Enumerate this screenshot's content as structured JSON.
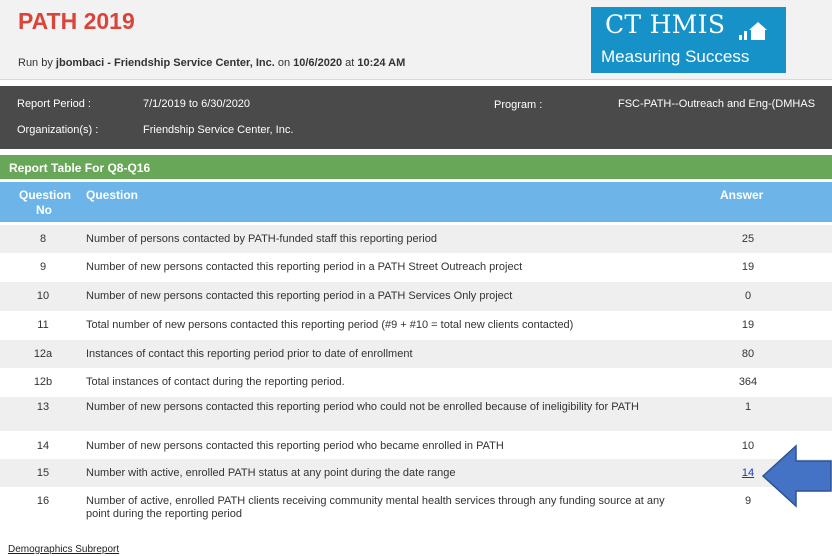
{
  "header": {
    "title": "PATH 2019",
    "run_by_prefix": "Run by ",
    "run_by_user": "jbombaci - Friendship Service Center, Inc.",
    "run_by_on": " on ",
    "run_date": "10/6/2020",
    "run_at": " at ",
    "run_time": "10:24 AM"
  },
  "logo": {
    "top": "CT HMIS",
    "bottom": "Measuring Success",
    "icon": "house-bars-icon"
  },
  "meta": {
    "report_period_label": "Report Period :",
    "report_period_value": "7/1/2019 to 6/30/2020",
    "program_label": "Program :",
    "program_value": "FSC-PATH--Outreach and Eng-(DMHAS",
    "organization_label": "Organization(s) :",
    "organization_value": "Friendship Service Center, Inc."
  },
  "table": {
    "section_title": "Report Table For Q8-Q16",
    "col_no_line1": "Question",
    "col_no_line2": "No",
    "col_question": "Question",
    "col_answer": "Answer",
    "rows": [
      {
        "no": "8",
        "question": "Number of persons contacted by PATH-funded staff this reporting period",
        "answer": "25"
      },
      {
        "no": "9",
        "question": "Number of new persons contacted this reporting period in a PATH Street Outreach project",
        "answer": "19"
      },
      {
        "no": "10",
        "question": "Number of new persons contacted this reporting period in a PATH Services Only project",
        "answer": "0"
      },
      {
        "no": "11",
        "question": "Total number of new persons contacted this reporting period (#9 + #10 = total new clients contacted)",
        "answer": "19"
      },
      {
        "no": "12a",
        "question": "Instances of contact this reporting period prior to date of enrollment",
        "answer": "80"
      },
      {
        "no": "12b",
        "question": "Total instances of contact during the reporting period.",
        "answer": "364"
      },
      {
        "no": "13",
        "question": "Number of new persons contacted this reporting period who could not be enrolled because of ineligibility for PATH",
        "answer": "1"
      },
      {
        "no": "14",
        "question": "Number of new persons contacted this reporting period who became enrolled in PATH",
        "answer": "10"
      },
      {
        "no": "15",
        "question": "Number with active, enrolled PATH status at any point during the date range",
        "answer": "14"
      },
      {
        "no": "16",
        "question": "Number of active, enrolled PATH clients receiving community mental health services through any funding source at any point during the reporting period",
        "answer": "9"
      }
    ]
  },
  "footer": {
    "demographics_link": "Demographics Subreport"
  },
  "colors": {
    "title": "#d9453a",
    "meta_bg": "#4a4a4a",
    "section_bg": "#67a757",
    "table_head_bg": "#6db5e8",
    "logo_bg": "#1792c8",
    "arrow": "#4472c4"
  }
}
